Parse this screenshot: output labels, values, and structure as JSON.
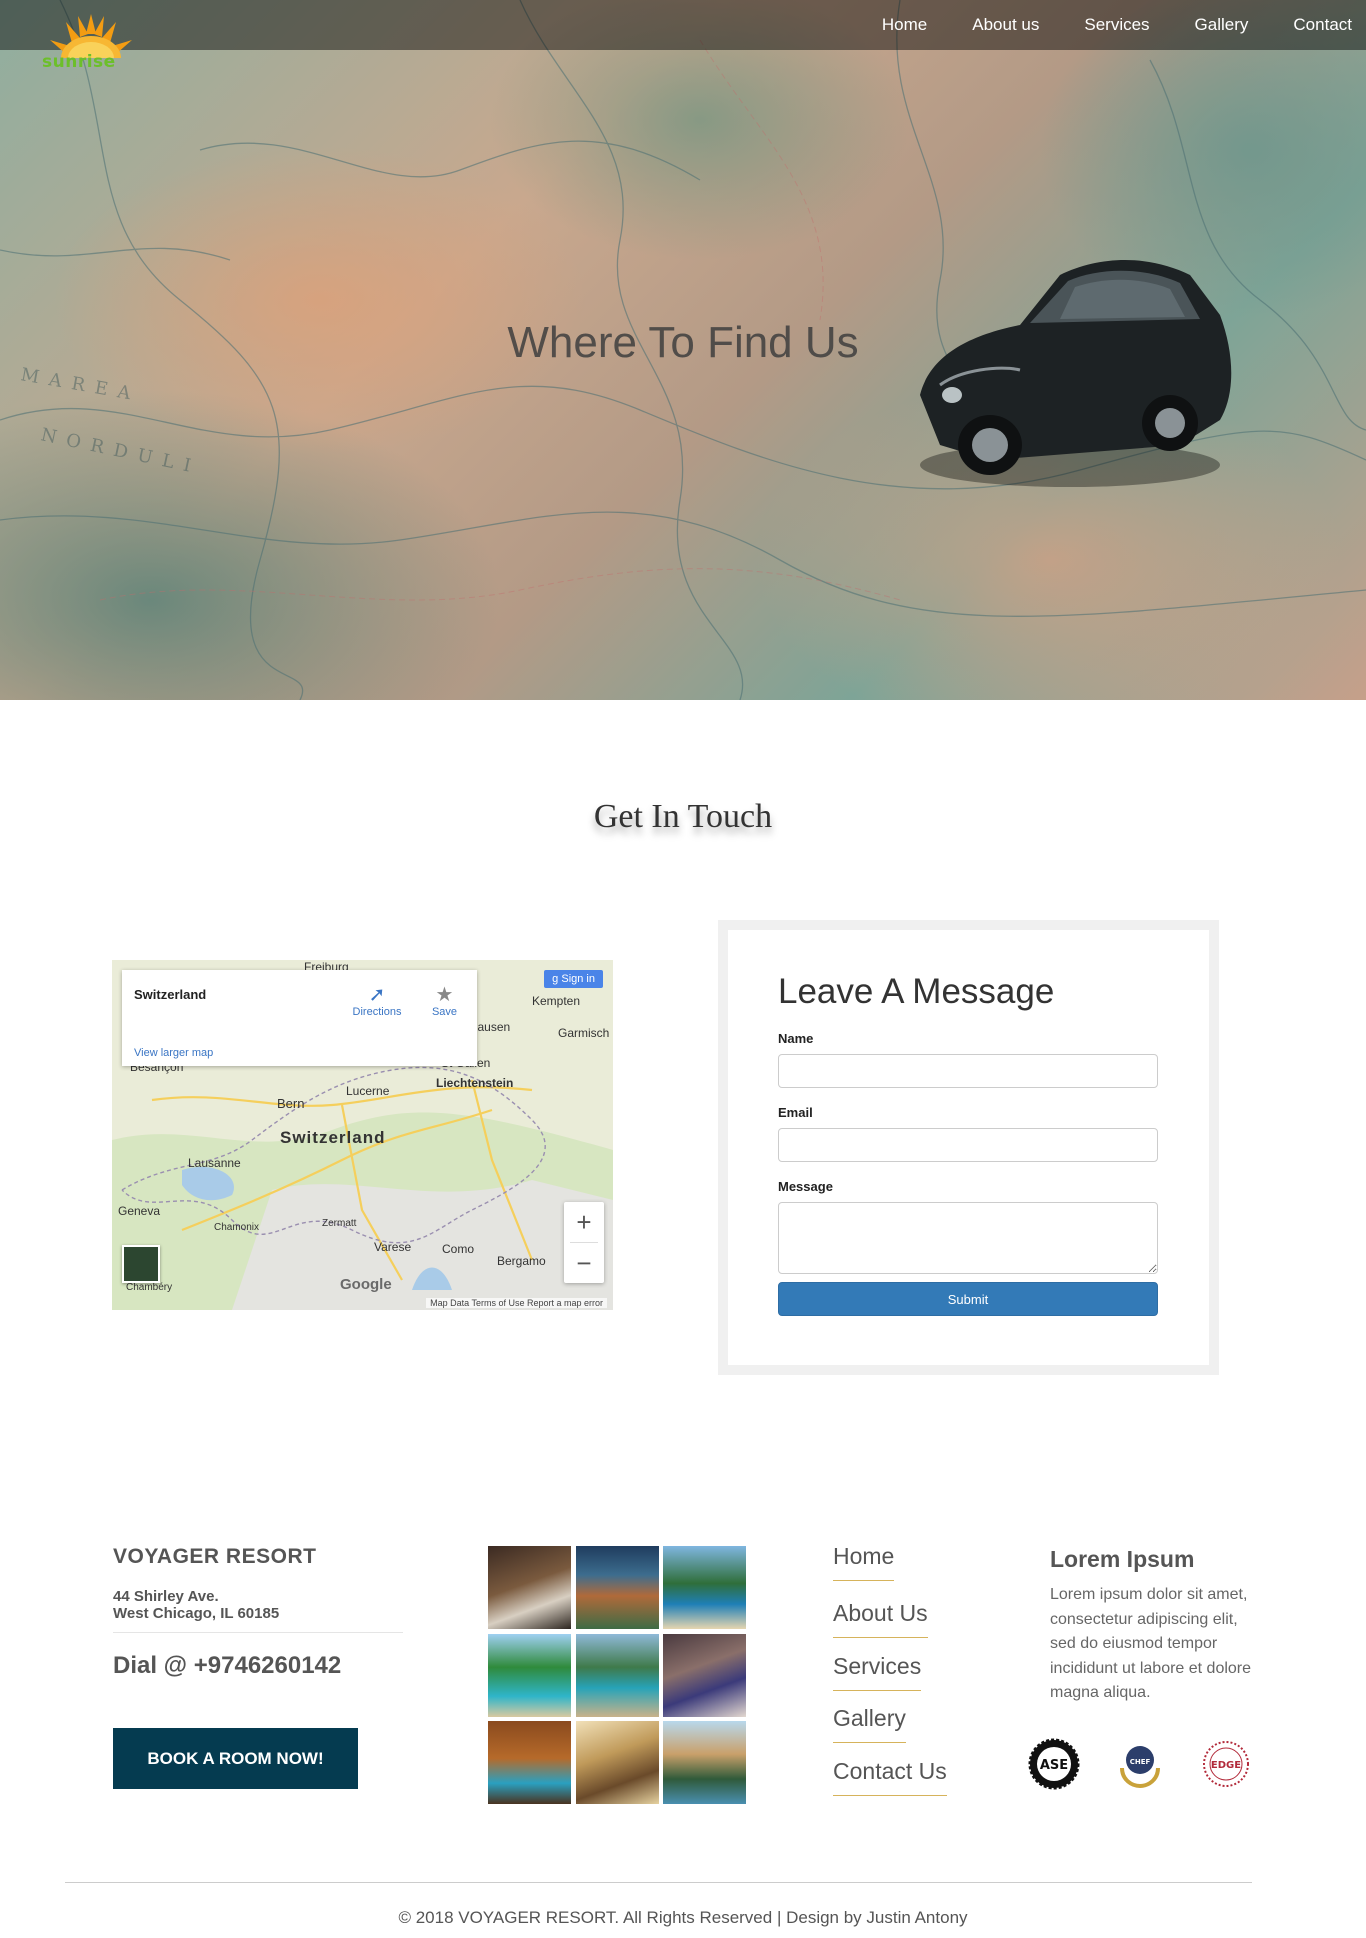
{
  "brand": {
    "name": "sunrise"
  },
  "nav": {
    "items": [
      "Home",
      "About us",
      "Services",
      "Gallery",
      "Contact"
    ]
  },
  "hero": {
    "title": "Where To Find Us"
  },
  "contact": {
    "section_title": "Get In Touch"
  },
  "map": {
    "place_name": "Switzerland",
    "directions_label": "Directions",
    "save_label": "Save",
    "view_larger_label": "View larger map",
    "sign_in_label": "Sign in",
    "google_label": "Google",
    "attribution": "Map Data  Terms of Use  Report a map error",
    "labels": [
      "Freiburg",
      "Kempten",
      "Garmisch",
      "Besançon",
      "St Gallen",
      "Liechtenstein",
      "Bern",
      "Lucerne",
      "Switzerland",
      "Lausanne",
      "Geneva",
      "Chamonix",
      "Zermatt",
      "Varese",
      "Como",
      "Bergamo",
      "Chambéry",
      "Schaffhausen"
    ]
  },
  "form": {
    "title": "Leave A Message",
    "name_label": "Name",
    "email_label": "Email",
    "message_label": "Message",
    "submit_label": "Submit"
  },
  "footer": {
    "resort_name": "VOYAGER RESORT",
    "address_line1": "44 Shirley Ave.",
    "address_line2": "West Chicago, IL 60185",
    "dial": "Dial @ +9746260142",
    "book_label": "BOOK A ROOM NOW!",
    "links": [
      "Home",
      "About Us",
      "Services",
      "Gallery",
      "Contact Us"
    ],
    "lorem_title": "Lorem Ipsum",
    "lorem_text": "Lorem ipsum dolor sit amet, consectetur adipiscing elit, sed do eiusmod tempor incididunt ut labore et dolore magna aliqua.",
    "badges": [
      "ASE",
      "CHEF",
      "EDGE"
    ],
    "copyright": "© 2018 VOYAGER RESORT. All Rights Reserved | Design by Justin Antony"
  },
  "colors": {
    "nav_overlay": "#000000",
    "book_button": "#053b50",
    "submit_button": "#337ab7",
    "link_underline": "#d6b35b",
    "logo_green": "#6cbf2a",
    "logo_orange": "#f39c12"
  }
}
